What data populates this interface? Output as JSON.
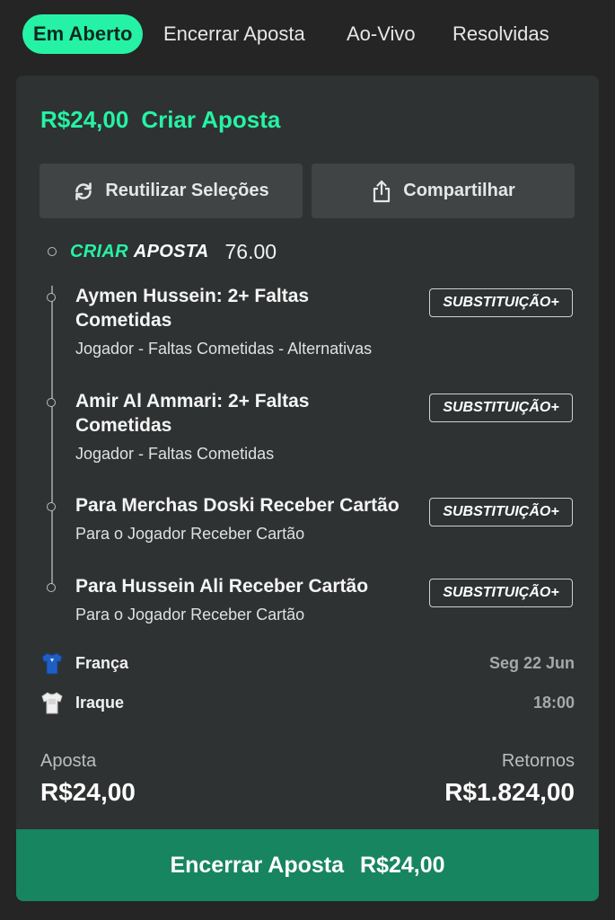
{
  "tabs": [
    {
      "label": "Em Aberto",
      "active": true
    },
    {
      "label": "Encerrar Aposta",
      "active": false
    },
    {
      "label": "Ao-Vivo",
      "active": false
    },
    {
      "label": "Resolvidas",
      "active": false
    }
  ],
  "bet": {
    "stake_title": "R$24,00",
    "type_title": "Criar Aposta",
    "reuse_label": "Reutilizar Seleções",
    "reuse_icon": "refresh-icon",
    "share_label": "Compartilhar",
    "share_icon": "share-icon",
    "brand_part1": "CRIAR",
    "brand_part2": "APOSTA",
    "odds": "76.00",
    "selections": [
      {
        "name": "Aymen Hussein: 2+ Faltas Cometidas",
        "market": "Jogador - Faltas Cometidas - Alternativas",
        "badge": "SUBSTITUIÇÃO+"
      },
      {
        "name": "Amir Al Ammari: 2+ Faltas Cometidas",
        "market": "Jogador - Faltas Cometidas",
        "badge": "SUBSTITUIÇÃO+"
      },
      {
        "name": "Para Merchas Doski Receber Cartão",
        "market": "Para o Jogador Receber Cartão",
        "badge": "SUBSTITUIÇÃO+"
      },
      {
        "name": "Para Hussein Ali Receber Cartão",
        "market": "Para o Jogador Receber Cartão",
        "badge": "SUBSTITUIÇÃO+"
      }
    ],
    "match": {
      "home": "França",
      "away": "Iraque",
      "date": "Seg 22 Jun",
      "time": "18:00"
    },
    "stake_label": "Aposta",
    "stake_value": "R$24,00",
    "returns_label": "Retornos",
    "returns_value": "R$1.824,00",
    "cashout_label": "Encerrar Aposta",
    "cashout_value": "R$24,00"
  },
  "colors": {
    "accent": "#26f2a5",
    "cashout_bg": "#178560",
    "card_bg": "#2f3232",
    "page_bg": "#252525"
  }
}
